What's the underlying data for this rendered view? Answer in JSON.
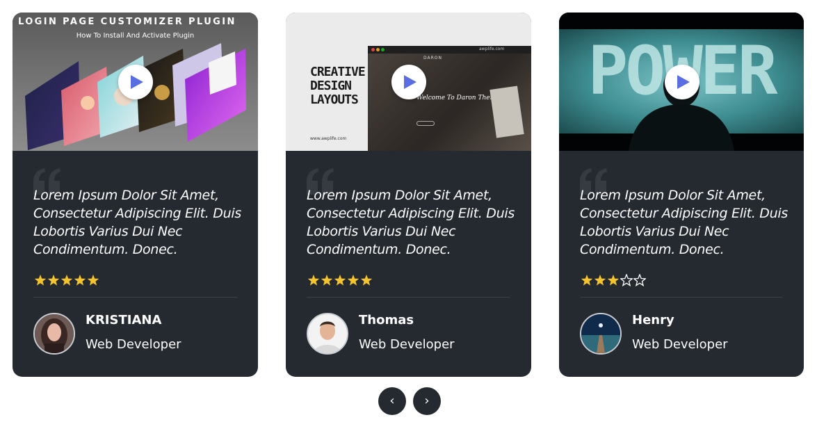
{
  "accent_colors": {
    "card_bg": "#252a31",
    "star": "#f4c430",
    "play_icon": "#5b6ee1"
  },
  "cards": [
    {
      "thumb_title": "LOGIN PAGE CUSTOMIZER PLUGIN",
      "thumb_subtitle": "How To Install And Activate Plugin",
      "quote": "Lorem Ipsum Dolor Sit Amet, Consectetur Adipiscing Elit. Duis Lobortis Varius Dui Nec Condimentum. Donec.",
      "rating": 5,
      "name": "KRISTIANA",
      "role": "Web Developer",
      "icon": "play-icon"
    },
    {
      "thumb_title_lines": [
        "CREATIVE",
        "DESIGN",
        "LAYOUTS"
      ],
      "thumb_url": "www.awplife.com",
      "thumb_browser_url": "awplife.com",
      "thumb_brand": "DARON",
      "thumb_welcome": "Welcome To Daron Theme",
      "quote": "Lorem Ipsum Dolor Sit Amet, Consectetur Adipiscing Elit. Duis Lobortis Varius Dui Nec Condimentum. Donec.",
      "rating": 5,
      "name": "Thomas",
      "role": "Web Developer",
      "icon": "play-icon"
    },
    {
      "thumb_word": "POWER",
      "quote": "Lorem Ipsum Dolor Sit Amet, Consectetur Adipiscing Elit. Duis Lobortis Varius Dui Nec Condimentum. Donec.",
      "rating": 3,
      "name": "Henry",
      "role": "Web Developer",
      "icon": "play-icon"
    }
  ],
  "nav": {
    "prev": "‹",
    "next": "›"
  }
}
